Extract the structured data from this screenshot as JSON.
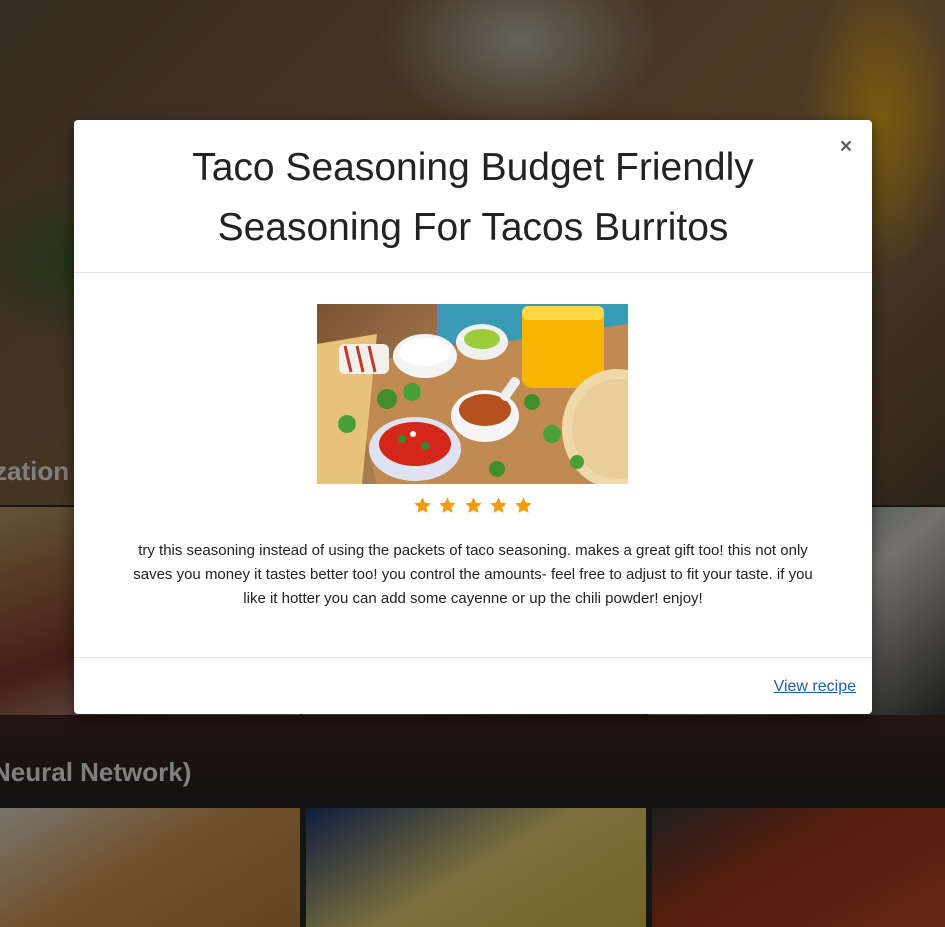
{
  "background": {
    "caption_top": "zation",
    "caption_bottom": "Neural Network)"
  },
  "modal": {
    "title": "Taco Seasoning Budget Friendly Seasoning For Tacos Burritos",
    "close_label": "×",
    "image_alt": "Taco Seasoning Budget Friendly Seasoning For Tacos Burritos",
    "rating": {
      "value": 5,
      "max": 5,
      "icon": "star-icon",
      "color": "#f39c12"
    },
    "description": "try this seasoning instead of using the packets of taco seasoning. makes a great gift too! this not only saves you money it tastes better too! you control the amounts- feel free to adjust to fit your taste. if you like it hotter you can add some cayenne or up the chili powder! enjoy!",
    "footer": {
      "view_recipe_label": "View recipe"
    }
  },
  "colors": {
    "link": "#1f5fa8",
    "star": "#f39c12",
    "backdrop": "rgba(0,0,0,0.5)"
  }
}
